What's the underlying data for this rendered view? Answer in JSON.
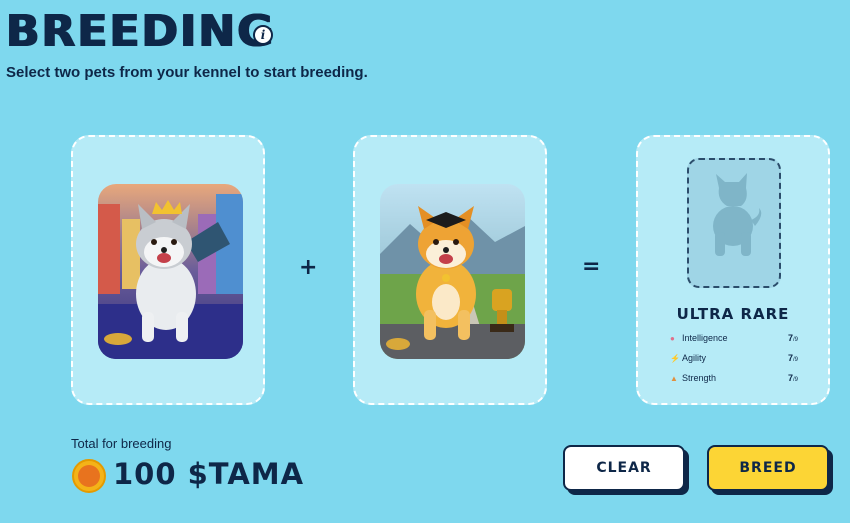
{
  "page": {
    "title": "BREEDING",
    "subtitle": "Select two pets from your kennel to start breeding."
  },
  "operators": {
    "plus": "+",
    "equals": "="
  },
  "result": {
    "rarity": "ULTRA RARE",
    "stats": [
      {
        "name": "Intelligence",
        "value": "7",
        "max": "/9",
        "icon": "brain-icon"
      },
      {
        "name": "Agility",
        "value": "7",
        "max": "/9",
        "icon": "lightning-icon"
      },
      {
        "name": "Strength",
        "value": "7",
        "max": "/9",
        "icon": "muscle-icon"
      }
    ]
  },
  "footer": {
    "total_label": "Total for breeding",
    "total_amount": "100 $TAMA"
  },
  "buttons": {
    "clear": "CLEAR",
    "breed": "BREED"
  },
  "colors": {
    "background": "#7ed8ee",
    "slot": "#b6ebf7",
    "text": "#0e2748",
    "breed_button": "#fcd535"
  }
}
